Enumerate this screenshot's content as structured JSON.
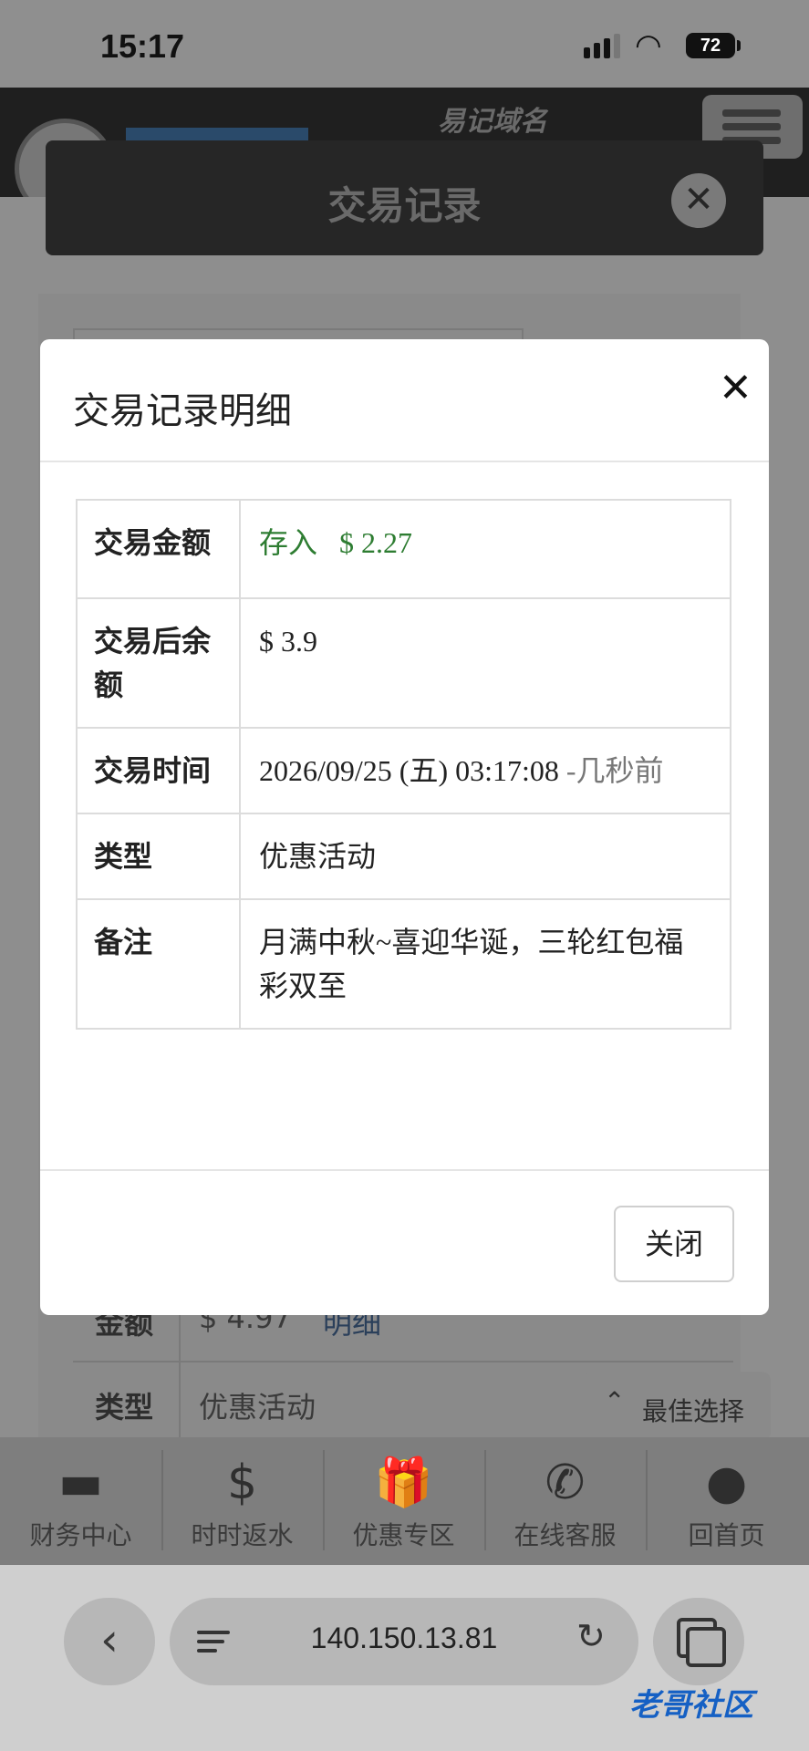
{
  "status_bar": {
    "time": "15:17",
    "battery": "72"
  },
  "site": {
    "title": "易记域名"
  },
  "bg_dialog": {
    "title": "交易记录",
    "close_symbol": "✕"
  },
  "bg_list": {
    "amount_label": "金额",
    "amount_value": "$ 4.97",
    "detail_link": "明细",
    "type_label": "类型",
    "type_value": "优惠活动"
  },
  "best_choice": {
    "label": "最佳选择",
    "icon": "⌃"
  },
  "bottom_nav": [
    {
      "label": "财务中心",
      "icon": "money-icon",
      "glyph": "▬"
    },
    {
      "label": "时时返水",
      "icon": "dollar-icon",
      "glyph": "$"
    },
    {
      "label": "优惠专区",
      "icon": "gift-icon",
      "glyph": "🎁"
    },
    {
      "label": "在线客服",
      "icon": "whatsapp-icon",
      "glyph": "✆"
    },
    {
      "label": "回首页",
      "icon": "home-icon",
      "glyph": "●"
    }
  ],
  "browser": {
    "url": "140.150.13.81",
    "back": "‹",
    "reload": "↻"
  },
  "watermark": "老哥社区",
  "modal": {
    "title": "交易记录明细",
    "close_symbol": "✕",
    "close_button": "关闭",
    "rows": [
      {
        "label": "交易金额",
        "type": "存入",
        "amount": "$ 2.27"
      },
      {
        "label": "交易后余额",
        "value": "$ 3.9"
      },
      {
        "label": "交易时间",
        "value": "2026/09/25 (五) 03:17:08",
        "ago": "-几秒前"
      },
      {
        "label": "类型",
        "value": "优惠活动"
      },
      {
        "label": "备注",
        "value": "月满中秋~喜迎华诞，三轮红包福彩双至"
      }
    ]
  },
  "colors": {
    "deposit_green": "#2e7d32",
    "link_blue": "#2a3f5a",
    "overlay": "#8e8e8e"
  }
}
